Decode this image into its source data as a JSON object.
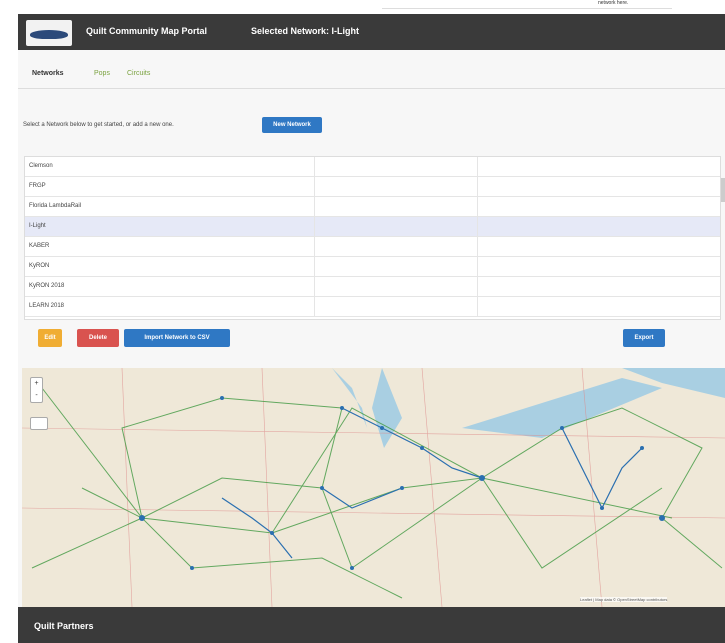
{
  "top_strip": {
    "note": "network here."
  },
  "header": {
    "brand": "Quilt Community Map Portal",
    "selected_network": "Selected Network: I-Light"
  },
  "tabs": [
    {
      "label": "Networks"
    },
    {
      "label": "Pops"
    },
    {
      "label": "Circuits"
    }
  ],
  "intro_text": "Select a Network below to get started, or add a new one.",
  "buttons": {
    "new_network": "New Network",
    "edit": "Edit",
    "delete": "Delete",
    "import": "Import Network to CSV",
    "export": "Export"
  },
  "networks": [
    {
      "name": "Clemson",
      "selected": false
    },
    {
      "name": "FRGP",
      "selected": false
    },
    {
      "name": "Florida LambdaRail",
      "selected": false
    },
    {
      "name": "I-Light",
      "selected": true
    },
    {
      "name": "KABER",
      "selected": false
    },
    {
      "name": "KyRON",
      "selected": false
    },
    {
      "name": "KyRON 2018",
      "selected": false
    },
    {
      "name": "LEARN 2018",
      "selected": false
    }
  ],
  "map": {
    "zoom_in": "+",
    "zoom_out": "-",
    "attribution": "Leaflet | Map data © OpenStreetMap contributors"
  },
  "footer": {
    "title": "Quilt Partners"
  }
}
